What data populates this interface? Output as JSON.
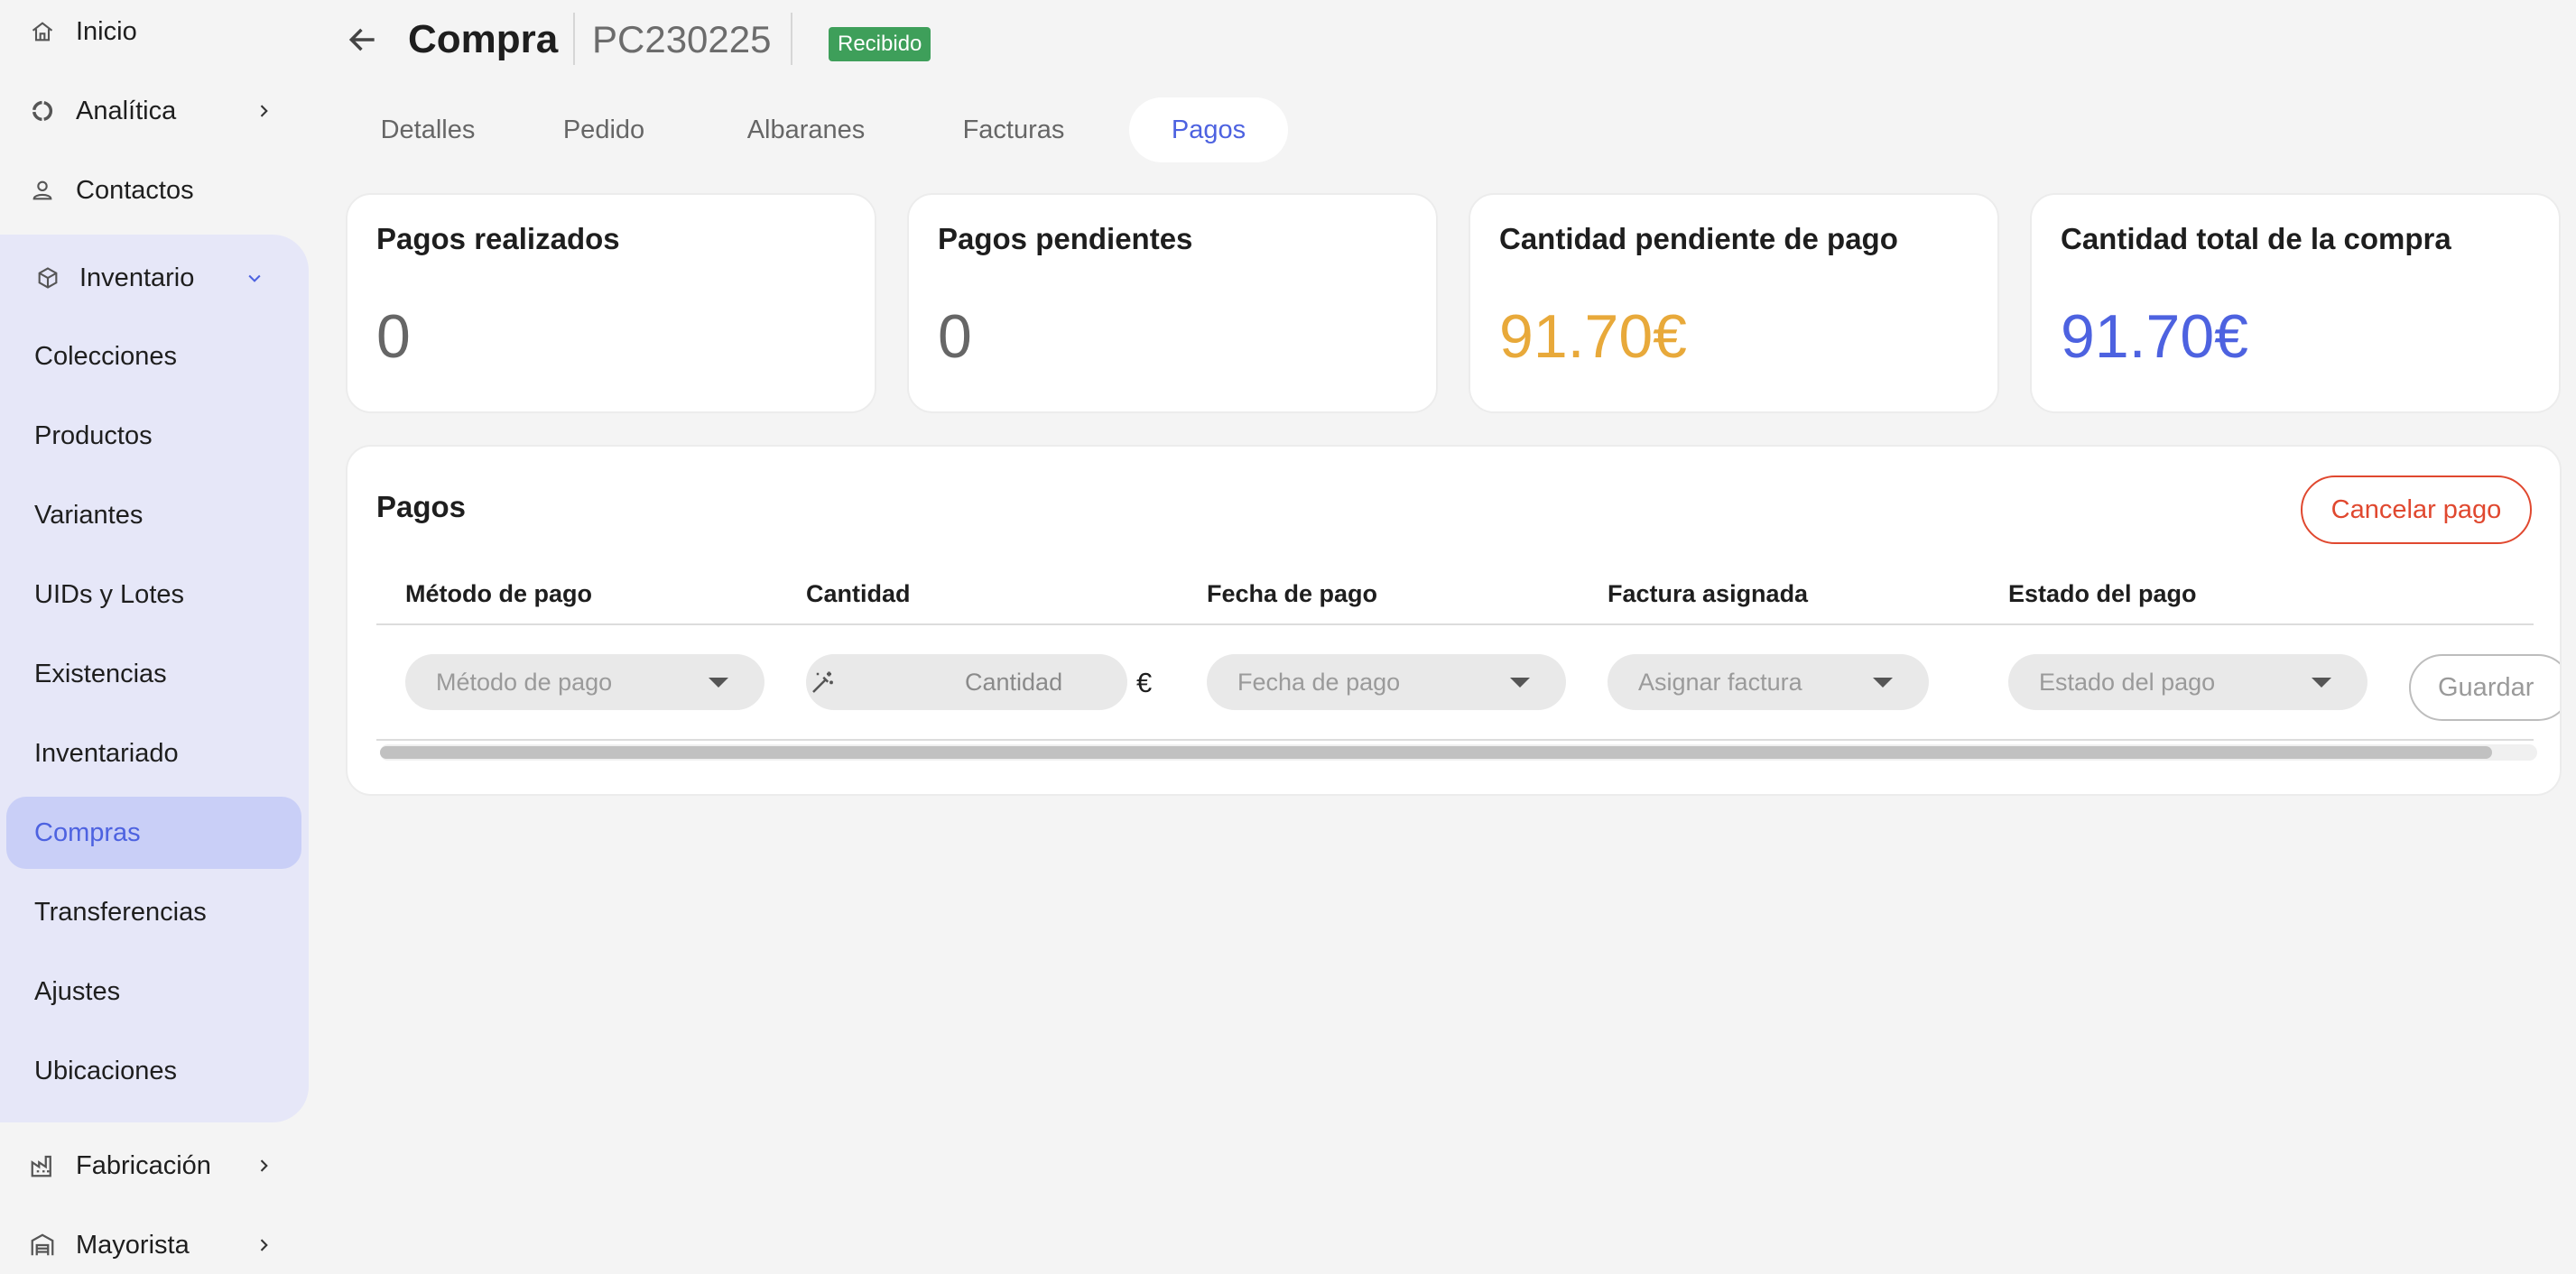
{
  "sidebar": {
    "inicio": "Inicio",
    "analitica": "Analítica",
    "contactos": "Contactos",
    "inventario": "Inventario",
    "inventory_items": [
      "Colecciones",
      "Productos",
      "Variantes",
      "UIDs y Lotes",
      "Existencias",
      "Inventariado",
      "Compras",
      "Transferencias",
      "Ajustes",
      "Ubicaciones"
    ],
    "active_item": "Compras",
    "fabricacion": "Fabricación",
    "mayorista": "Mayorista"
  },
  "header": {
    "title": "Compra",
    "code": "PC230225",
    "status_badge": "Recibido"
  },
  "tabs": [
    "Detalles",
    "Pedido",
    "Albaranes",
    "Facturas",
    "Pagos"
  ],
  "active_tab": "Pagos",
  "stats": [
    {
      "label": "Pagos realizados",
      "value": "0",
      "color": "#666666"
    },
    {
      "label": "Pagos pendientes",
      "value": "0",
      "color": "#666666"
    },
    {
      "label": "Cantidad pendiente de pago",
      "value": "91.70€",
      "color": "#e8a93a"
    },
    {
      "label": "Cantidad total de la compra",
      "value": "91.70€",
      "color": "#4d62e0"
    }
  ],
  "payments": {
    "title": "Pagos",
    "cancel_label": "Cancelar pago",
    "columns": [
      "Método de pago",
      "Cantidad",
      "Fecha de pago",
      "Factura asignada",
      "Estado del pago"
    ],
    "row": {
      "method_placeholder": "Método de pago",
      "amount_placeholder": "Cantidad",
      "currency": "€",
      "date_placeholder": "Fecha de pago",
      "invoice_placeholder": "Asignar factura",
      "status_placeholder": "Estado del pago",
      "save_label": "Guardar"
    }
  },
  "colors": {
    "accent": "#4d62e0",
    "success": "#3e9f5a",
    "danger": "#e0482f",
    "warning": "#e8a93a"
  }
}
